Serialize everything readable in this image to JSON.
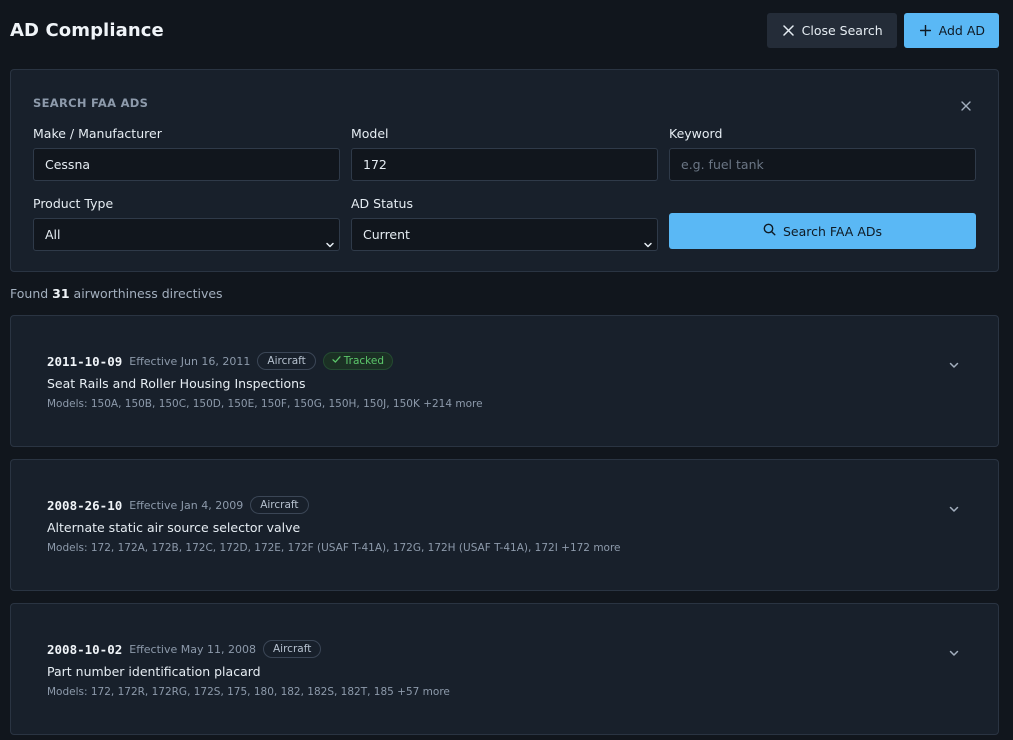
{
  "header": {
    "title": "AD Compliance",
    "close_search_label": "Close Search",
    "add_ad_label": "Add AD"
  },
  "search": {
    "title": "SEARCH FAA ADS",
    "make_label": "Make / Manufacturer",
    "make_value": "Cessna",
    "model_label": "Model",
    "model_value": "172",
    "keyword_label": "Keyword",
    "keyword_placeholder": "e.g. fuel tank",
    "product_type_label": "Product Type",
    "product_type_value": "All",
    "status_label": "AD Status",
    "status_value": "Current",
    "search_button_label": "Search FAA ADs"
  },
  "results": {
    "prefix": "Found",
    "count": "31",
    "suffix": "airworthiness directives",
    "items": [
      {
        "ad_number": "2011-10-09",
        "effective": "Effective Jun 16, 2011",
        "product": "Aircraft",
        "tracked": "Tracked",
        "subject": "Seat Rails and Roller Housing Inspections",
        "models": "Models: 150A, 150B, 150C, 150D, 150E, 150F, 150G, 150H, 150J, 150K +214 more"
      },
      {
        "ad_number": "2008-26-10",
        "effective": "Effective Jan 4, 2009",
        "product": "Aircraft",
        "subject": "Alternate static air source selector valve",
        "models": "Models: 172, 172A, 172B, 172C, 172D, 172E, 172F (USAF T-41A), 172G, 172H (USAF T-41A), 172I +172 more"
      },
      {
        "ad_number": "2008-10-02",
        "effective": "Effective May 11, 2008",
        "product": "Aircraft",
        "subject": "Part number identification placard",
        "models": "Models: 172, 172R, 172RG, 172S, 175, 180, 182, 182S, 182T, 185 +57 more"
      }
    ]
  },
  "icons": {
    "close": "close-icon",
    "plus": "plus-icon",
    "search": "search-icon",
    "chevron": "chevron-down-icon",
    "check": "check-icon"
  },
  "colors": {
    "accent": "#5ab8f5",
    "background": "#11161d",
    "panel": "#18202b",
    "tracked": "#5cc76b"
  }
}
